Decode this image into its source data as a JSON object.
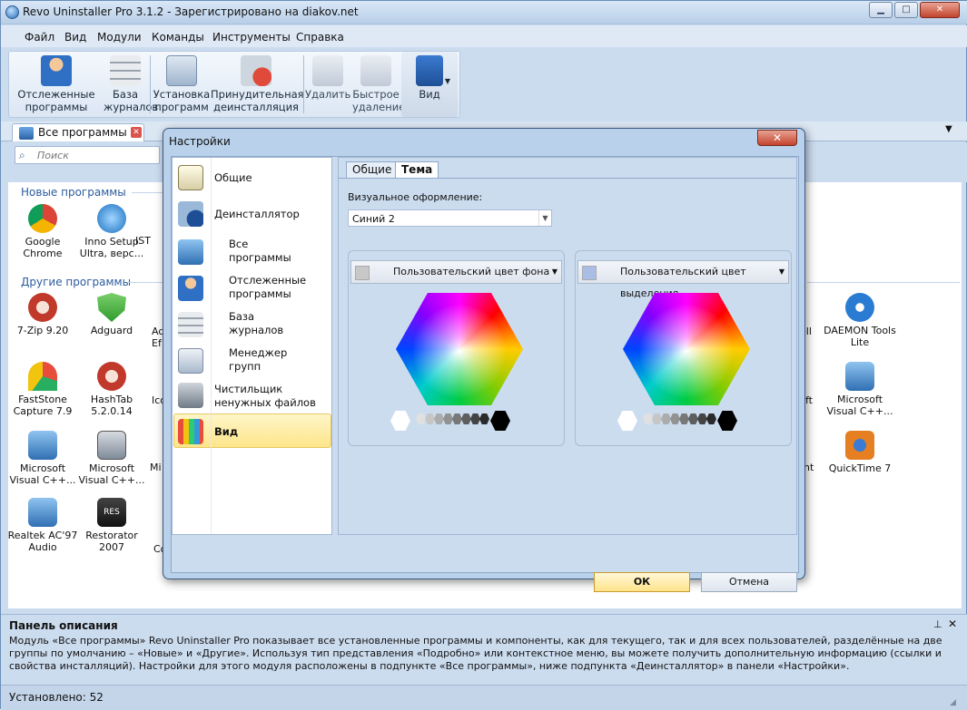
{
  "window": {
    "title": "Revo Uninstaller Pro 3.1.2 - Зарегистрировано на diakov.net"
  },
  "menu": [
    "Файл",
    "Вид",
    "Модули",
    "Команды",
    "Инструменты",
    "Справка"
  ],
  "toolbar": {
    "traced": "Отслеженные программы",
    "logs": "База журналов",
    "install": "Установка программ",
    "forced": "Принудительная деинсталляция",
    "delete": "Удалить",
    "quick": "Быстрое удаление",
    "view": "Вид"
  },
  "tabs": {
    "all": "Все программы"
  },
  "search": {
    "placeholder": "Поиск"
  },
  "groups": {
    "new": "Новые программы",
    "other": "Другие программы"
  },
  "new_programs": [
    "Google Chrome",
    "Inno Setup Ultra, верс...",
    "IST"
  ],
  "other_programs": [
    "7-Zip 9.20",
    "Adguard",
    "Ad Ef",
    "DAEMON Tools Lite",
    "FastStone Capture 7.9",
    "HashTab 5.2.0.14",
    "Ico",
    "Microsoft Visual C++...",
    "Microsoft Visual C++...",
    "Microsoft Visual C++...",
    "Mi",
    "QuickTime 7",
    "Realtek AC'97 Audio",
    "Restorator 2007",
    "Co"
  ],
  "side_partial": {
    "r1": "ell",
    "r2": "ft",
    "r3": "nt"
  },
  "dialog": {
    "title": "Настройки",
    "nav": {
      "general": "Общие",
      "uninstaller": "Деинсталлятор",
      "all": "Все программы",
      "traced": "Отслеженные программы",
      "logs": "База журналов",
      "groups": "Менеджер групп",
      "cleaner": "Чистильщик ненужных файлов",
      "view": "Вид"
    },
    "tabs": {
      "general": "Общие",
      "theme": "Тема"
    },
    "visual_label": "Визуальное оформление:",
    "theme_value": "Синий 2",
    "bg_color_button": "Пользовательский цвет фона",
    "sel_color_button": "Пользовательский цвет выделения",
    "bg_swatch": "#c8c8c8",
    "sel_swatch": "#a9bde6",
    "ok": "ОК",
    "cancel": "Отмена"
  },
  "desc_panel": {
    "title": "Панель описания",
    "text": "Модуль «Все программы» Revo Uninstaller Pro показывает все установленные программы и компоненты, как для текущего, так и для всех пользователей, разделённые на две группы по умолчанию – «Новые» и «Другие». Используя тип представления «Подробно» или контекстное меню, вы можете получить дополнительную информацию (ссылки и свойства инсталляций). Настройки для этого модуля расположены в подпункте «Все программы», ниже подпункта «Деинсталлятор» в панели «Настройки»."
  },
  "status": "Установлено: 52"
}
